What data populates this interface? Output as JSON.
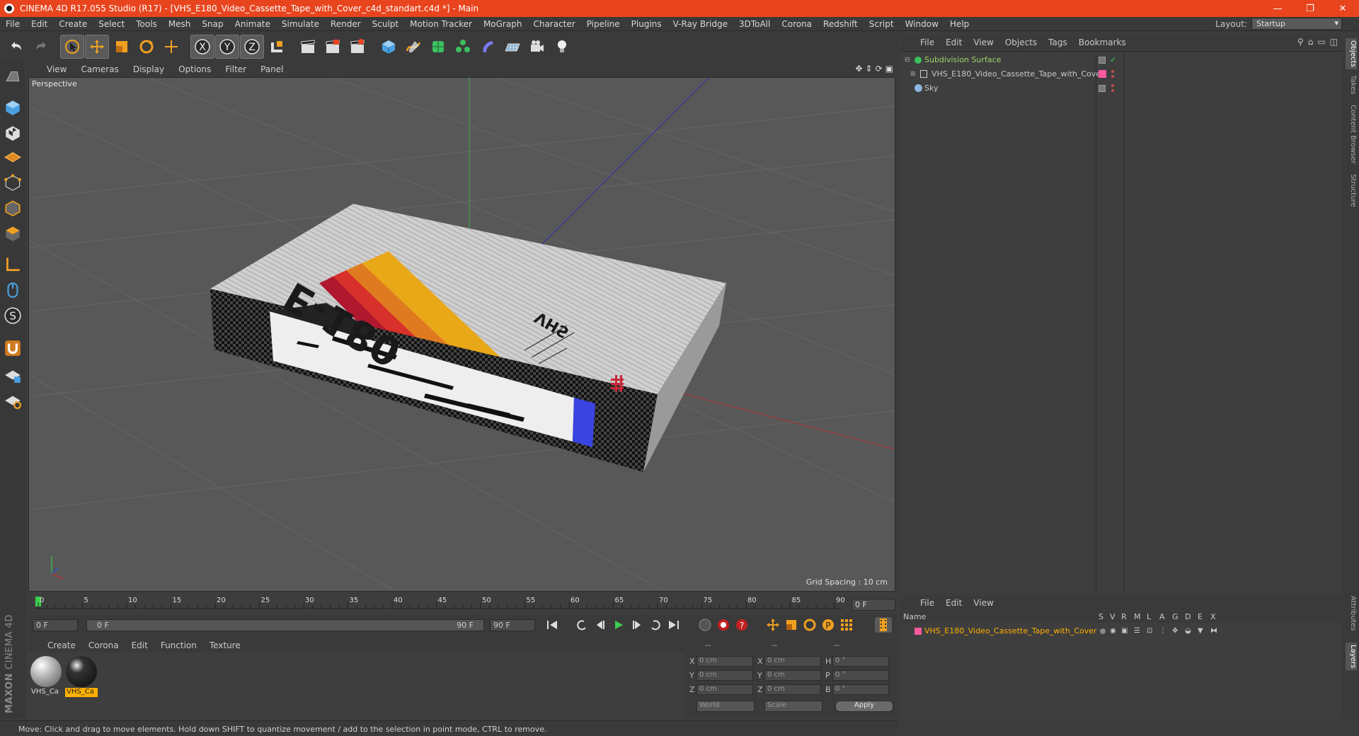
{
  "window": {
    "title": "CINEMA 4D R17.055 Studio (R17) - [VHS_E180_Video_Cassette_Tape_with_Cover_c4d_standart.c4d *] - Main",
    "minimize": "—",
    "restore": "❐",
    "close": "✕"
  },
  "menu": [
    "File",
    "Edit",
    "Create",
    "Select",
    "Tools",
    "Mesh",
    "Snap",
    "Animate",
    "Simulate",
    "Render",
    "Sculpt",
    "Motion Tracker",
    "MoGraph",
    "Character",
    "Pipeline",
    "Plugins",
    "V-Ray Bridge",
    "3DToAll",
    "Corona",
    "Redshift",
    "Script",
    "Window",
    "Help"
  ],
  "layout": {
    "label": "Layout:",
    "value": "Startup"
  },
  "toolbar": {
    "x_label": "X",
    "y_label": "Y",
    "z_label": "Z"
  },
  "viewport": {
    "menu": [
      "View",
      "Cameras",
      "Display",
      "Options",
      "Filter",
      "Panel"
    ],
    "camera_label": "Perspective",
    "grid_spacing": "Grid Spacing : 10 cm",
    "cassette_title": "E-180",
    "cassette_brand": "VHS"
  },
  "timeline": {
    "ticks": [
      "0",
      "5",
      "10",
      "15",
      "20",
      "25",
      "30",
      "35",
      "40",
      "45",
      "50",
      "55",
      "60",
      "65",
      "70",
      "75",
      "80",
      "85",
      "90"
    ],
    "current_frame": "0 F"
  },
  "transport": {
    "start_frame": "0 F",
    "range_start": "0 F",
    "range_end": "90 F",
    "end_frame": "90 F"
  },
  "material_manager": {
    "menu": [
      "Create",
      "Corona",
      "Edit",
      "Function",
      "Texture"
    ],
    "materials": [
      {
        "label": "VHS_Ca",
        "selected": false
      },
      {
        "label": "VHS_Ca",
        "selected": true
      }
    ]
  },
  "coordinates": {
    "header": [
      "--",
      "--",
      "--"
    ],
    "rows": [
      {
        "axis": "X",
        "pos": "0 cm",
        "size_axis": "X",
        "size": "0 cm",
        "rot_axis": "H",
        "rot": "0 °"
      },
      {
        "axis": "Y",
        "pos": "0 cm",
        "size_axis": "Y",
        "size": "0 cm",
        "rot_axis": "P",
        "rot": "0 °"
      },
      {
        "axis": "Z",
        "pos": "0 cm",
        "size_axis": "Z",
        "size": "0 cm",
        "rot_axis": "B",
        "rot": "0 °"
      }
    ],
    "space": "World",
    "mode": "Scale",
    "apply": "Apply"
  },
  "brand": {
    "maxon": "MAXON",
    "product": "CINEMA 4D"
  },
  "status": "Move: Click and drag to move elements. Hold down SHIFT to quantize movement / add to the selection in point mode, CTRL to remove.",
  "object_manager": {
    "menu": [
      "File",
      "Edit",
      "View",
      "Objects",
      "Tags",
      "Bookmarks"
    ],
    "objects": [
      {
        "name": "Subdivision Surface",
        "color": "#9ed36a"
      },
      {
        "name": "VHS_E180_Video_Cassette_Tape_with_Cover",
        "color": "#c8c8c8"
      },
      {
        "name": "Sky",
        "color": "#c8c8c8"
      }
    ]
  },
  "layer_manager": {
    "menu": [
      "File",
      "Edit",
      "View"
    ],
    "columns": [
      "Name",
      "S",
      "V",
      "R",
      "M",
      "L",
      "A",
      "G",
      "D",
      "E",
      "X"
    ],
    "layers": [
      {
        "name": "VHS_E180_Video_Cassette_Tape_with_Cover",
        "color": "#ff5aa0"
      }
    ]
  },
  "right_tabs": [
    "Objects",
    "Takes",
    "Content Browser",
    "Structure",
    "Attributes",
    "Layers"
  ],
  "colors": {
    "title_bar": "#e8451e",
    "accent": "#ffb000",
    "selected_label": "#ffb000"
  }
}
